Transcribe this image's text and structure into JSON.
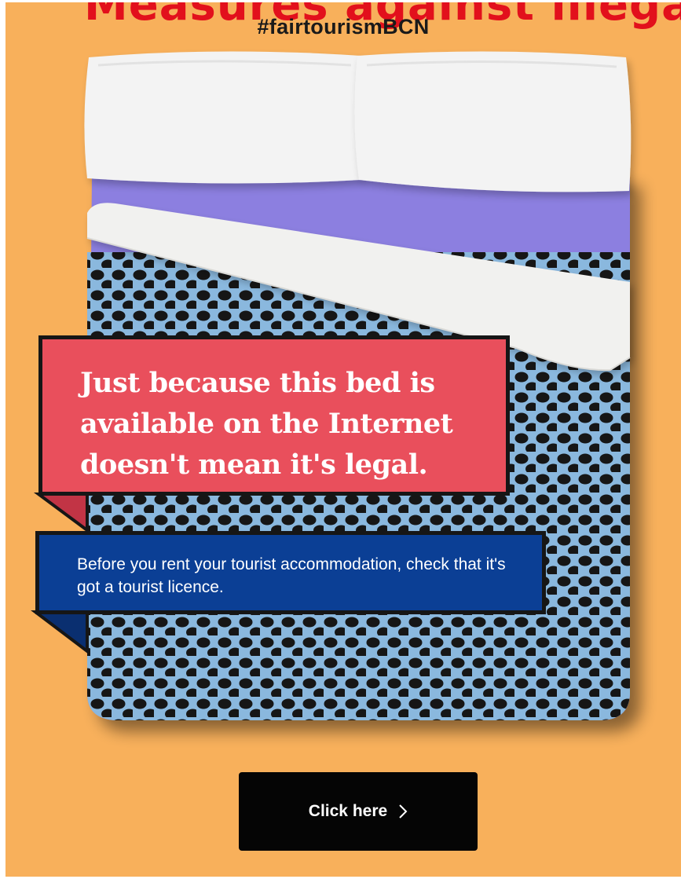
{
  "banner": {
    "title_clipped": "Measures against illegal tourist",
    "hashtag": "#fairtourismBCN",
    "headline": "Just because this bed is available on the Internet doesn't mean it's legal.",
    "message": "Before you rent your tourist accommodation, check that it's got a tourist licence.",
    "cta_label": "Click here",
    "icons": {
      "cta": "chevron-right-icon"
    },
    "colors": {
      "background": "#f8b05b",
      "headline_box": "#e94f5c",
      "info_box": "#0b3f95",
      "sheet": "#8c7fe0",
      "duvet": "#8ab8de",
      "dots": "#161616",
      "cta": "#050505",
      "title": "#e2101c"
    }
  }
}
